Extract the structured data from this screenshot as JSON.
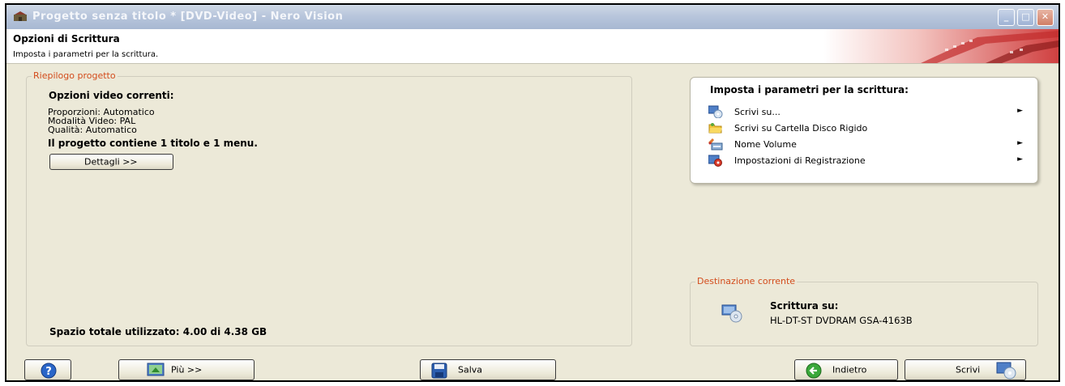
{
  "window": {
    "title": "Progetto senza titolo * [DVD-Video] - Nero Vision",
    "controls": {
      "minimize": "_",
      "maximize": "□",
      "close": "✕"
    }
  },
  "header": {
    "title": "Opzioni di Scrittura",
    "subtitle": "Imposta i parametri per la scrittura."
  },
  "summary": {
    "legend": "Riepilogo progetto",
    "heading": "Opzioni video correnti:",
    "lines": [
      "Proporzioni: Automatico",
      "Modalità Video: PAL",
      "Qualità: Automatico"
    ],
    "content_note": "Il progetto contiene 1 titolo e 1 menu.",
    "details_button": "Dettagli >>",
    "space_used": "Spazio totale utilizzato: 4.00 di 4.38 GB"
  },
  "taskpane": {
    "title": "Imposta i parametri per la scrittura:",
    "items": [
      {
        "label": "Scrivi su...",
        "icon": "burn-to-icon",
        "has_submenu": true
      },
      {
        "label": "Scrivi su Cartella Disco Rigido",
        "icon": "folder-icon",
        "has_submenu": false
      },
      {
        "label": "Nome Volume",
        "icon": "volume-name-icon",
        "has_submenu": true
      },
      {
        "label": "Impostazioni di Registrazione",
        "icon": "recording-settings-icon",
        "has_submenu": true
      }
    ],
    "arrow": "►"
  },
  "destination": {
    "legend": "Destinazione corrente",
    "label": "Scrittura su:",
    "device": "HL-DT-ST DVDRAM GSA-4163B"
  },
  "bottom": {
    "help": "?",
    "more": "Più >>",
    "save": "Salva",
    "back": "Indietro",
    "burn": "Scrivi"
  },
  "colors": {
    "accent_legend": "#d34c1c",
    "window_bg": "#ece9d8",
    "titlebar": "#b8c6dc"
  }
}
